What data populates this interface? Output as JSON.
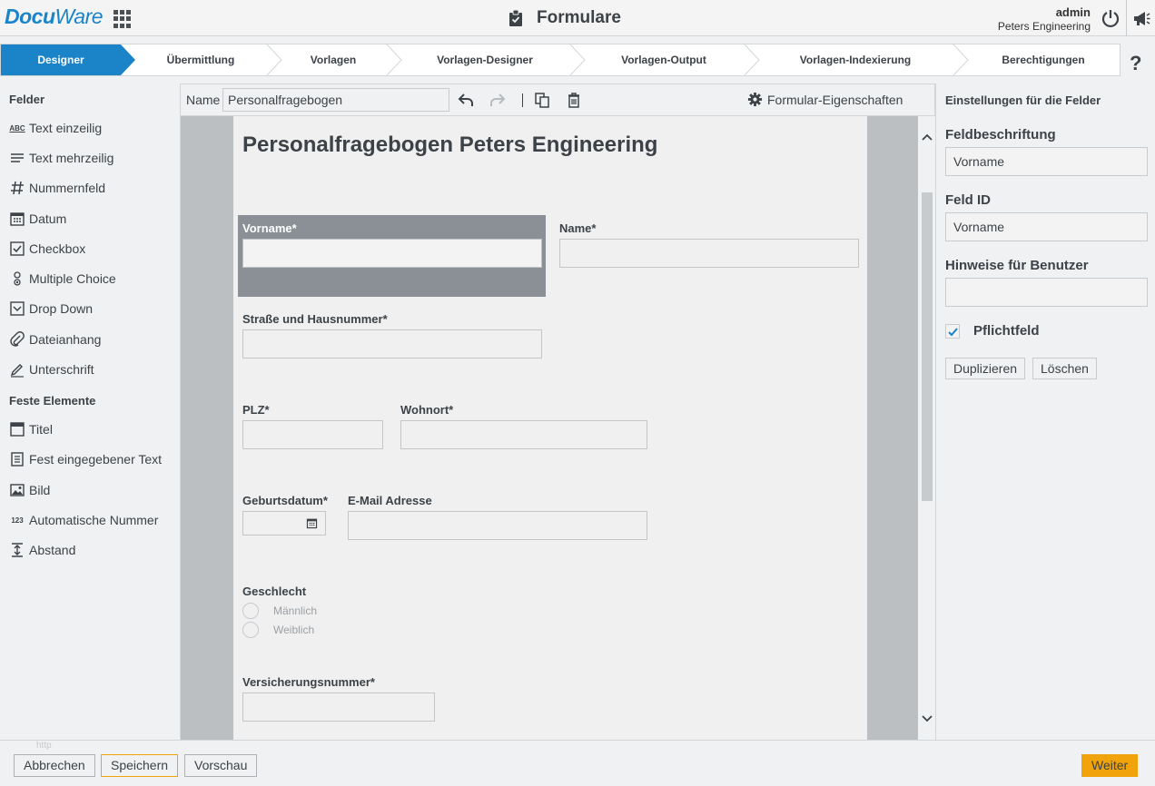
{
  "header": {
    "logo": "DocuWare",
    "title": "Formulare",
    "user_name": "admin",
    "organization": "Peters Engineering",
    "icons": [
      "apps-grid-icon",
      "clipboard-icon",
      "power-icon",
      "megaphone-icon"
    ]
  },
  "steps": [
    {
      "label": "Designer",
      "active": true
    },
    {
      "label": "Übermittlung",
      "active": false
    },
    {
      "label": "Vorlagen",
      "active": false
    },
    {
      "label": "Vorlagen-Designer",
      "active": false
    },
    {
      "label": "Vorlagen-Output",
      "active": false
    },
    {
      "label": "Vorlagen-Indexierung",
      "active": false
    },
    {
      "label": "Berechtigungen",
      "active": false
    }
  ],
  "help_label": "?",
  "palette": {
    "fields_heading": "Felder",
    "fields": [
      {
        "label": "Text einzeilig",
        "icon": "abc-icon"
      },
      {
        "label": "Text mehrzeilig",
        "icon": "lines-icon"
      },
      {
        "label": "Nummernfeld",
        "icon": "hash-icon"
      },
      {
        "label": "Datum",
        "icon": "calendar-icon"
      },
      {
        "label": "Checkbox",
        "icon": "checkbox-icon"
      },
      {
        "label": "Multiple Choice",
        "icon": "radio-icon"
      },
      {
        "label": "Drop Down",
        "icon": "dropdown-icon"
      },
      {
        "label": "Dateianhang",
        "icon": "paperclip-icon"
      },
      {
        "label": "Unterschrift",
        "icon": "pen-icon"
      }
    ],
    "fixed_heading": "Feste Elemente",
    "fixed": [
      {
        "label": "Titel",
        "icon": "title-icon"
      },
      {
        "label": "Fest eingegebener Text",
        "icon": "text-block-icon"
      },
      {
        "label": "Bild",
        "icon": "image-icon"
      },
      {
        "label": "Automatische Nummer",
        "icon": "auto-number-icon"
      },
      {
        "label": "Abstand",
        "icon": "spacing-icon"
      }
    ],
    "abc_glyph": "ABC",
    "num_glyph": "123"
  },
  "toolbar": {
    "name_label": "Name",
    "name_value": "Personalfragebogen",
    "properties_label": "Formular-Eigenschaften"
  },
  "form": {
    "title": "Personalfragebogen Peters Engineering",
    "fields": {
      "vorname": "Vorname*",
      "name": "Name*",
      "strasse": "Straße und Hausnummer*",
      "plz": "PLZ*",
      "wohnort": "Wohnort*",
      "geburtsdatum": "Geburtsdatum*",
      "email": "E-Mail Adresse",
      "geschlecht": "Geschlecht",
      "versicherung": "Versicherungsnummer*"
    },
    "gender_options": [
      "Männlich",
      "Weiblich"
    ]
  },
  "settings": {
    "heading": "Einstellungen für die Felder",
    "label_caption": "Feldbeschriftung",
    "label_value": "Vorname",
    "id_caption": "Feld ID",
    "id_value": "Vorname",
    "hint_caption": "Hinweise für Benutzer",
    "hint_value": "",
    "required_label": "Pflichtfeld",
    "required_checked": true,
    "duplicate_button": "Duplizieren",
    "delete_button": "Löschen"
  },
  "footer": {
    "cancel": "Abbrechen",
    "save": "Speichern",
    "preview": "Vorschau",
    "next": "Weiter",
    "ghost_text": "http"
  },
  "colors": {
    "accent": "#1b84c9",
    "action": "#f0a30a",
    "selection": "#8a9096"
  }
}
